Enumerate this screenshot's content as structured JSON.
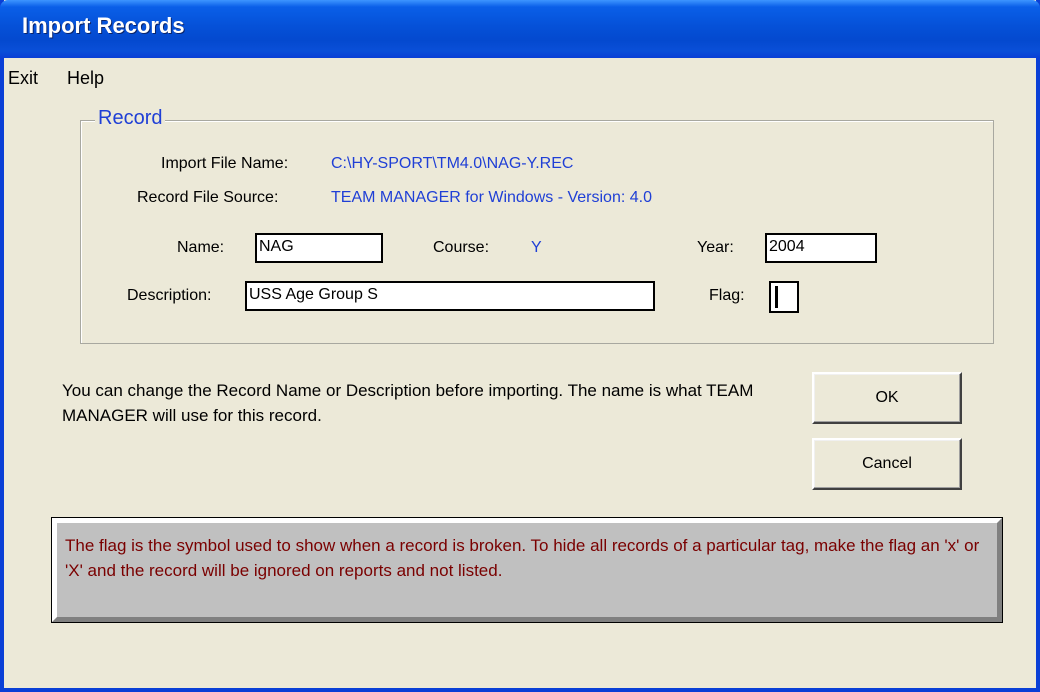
{
  "window": {
    "title": "Import Records"
  },
  "menu": {
    "items": [
      "Exit",
      "Help"
    ]
  },
  "record": {
    "group_label": "Record",
    "import_file_label": "Import File Name:",
    "import_file_value": "C:\\HY-SPORT\\TM4.0\\NAG-Y.REC",
    "source_label": "Record File Source:",
    "source_value": "TEAM MANAGER for Windows - Version: 4.0",
    "name_label": "Name:",
    "name_value": "NAG",
    "course_label": "Course:",
    "course_value": "Y",
    "year_label": "Year:",
    "year_value": "2004",
    "description_label": "Description:",
    "description_value": "USS Age Group S",
    "flag_label": "Flag:",
    "flag_value": ""
  },
  "note": "You can change the Record Name or Description  before importing.  The name is what TEAM MANAGER will use for this record.",
  "buttons": {
    "ok": "OK",
    "cancel": "Cancel"
  },
  "info": "The flag is the symbol used to show when a record is broken. To hide all records of a particular tag, make the flag an 'x' or 'X' and the record will be ignored on reports and not listed.",
  "colors": {
    "titlebar": "#0a5fe8",
    "accent_text": "#1f3fd6",
    "info_text": "#7a0000",
    "info_bg": "#c0c0c0"
  }
}
